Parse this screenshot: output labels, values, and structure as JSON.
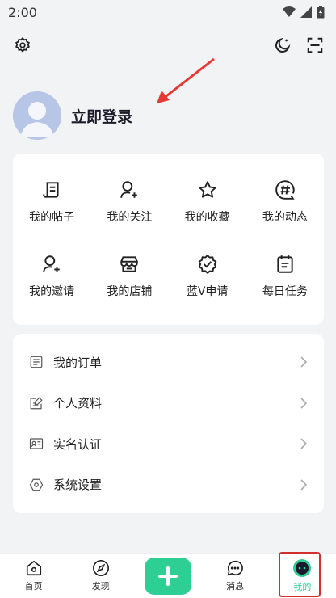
{
  "status_bar": {
    "time": "2:00"
  },
  "profile": {
    "login_text": "立即登录"
  },
  "grid": [
    {
      "label": "我的帖子",
      "icon": "post-icon"
    },
    {
      "label": "我的关注",
      "icon": "follow-icon"
    },
    {
      "label": "我的收藏",
      "icon": "star-icon"
    },
    {
      "label": "我的动态",
      "icon": "hashtag-icon"
    },
    {
      "label": "我的邀请",
      "icon": "invite-icon"
    },
    {
      "label": "我的店铺",
      "icon": "store-icon"
    },
    {
      "label": "蓝V申请",
      "icon": "verified-icon"
    },
    {
      "label": "每日任务",
      "icon": "task-icon"
    }
  ],
  "list": [
    {
      "label": "我的订单",
      "icon": "order-icon"
    },
    {
      "label": "个人资料",
      "icon": "profile-edit-icon"
    },
    {
      "label": "实名认证",
      "icon": "id-card-icon"
    },
    {
      "label": "系统设置",
      "icon": "hexagon-settings-icon"
    }
  ],
  "nav": [
    {
      "label": "首页",
      "icon": "home-icon"
    },
    {
      "label": "发现",
      "icon": "compass-icon"
    },
    {
      "label": "",
      "icon": "plus-icon"
    },
    {
      "label": "消息",
      "icon": "message-icon"
    },
    {
      "label": "我的",
      "icon": "me-icon"
    }
  ],
  "colors": {
    "accent": "#2dcf94",
    "annotation": "#d32f2f",
    "background": "#f2f3f5"
  }
}
